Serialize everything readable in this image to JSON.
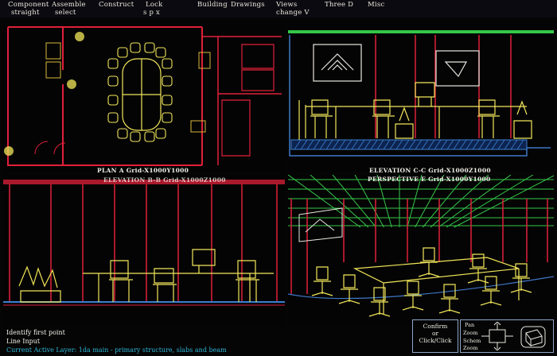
{
  "menu": {
    "row1": [
      "Component",
      "Assemble",
      "Construct",
      "Lock",
      "Building",
      "Drawings",
      "Views",
      "Three D",
      "Misc"
    ],
    "row2": [
      "straight",
      "select",
      "s p x",
      "change V"
    ]
  },
  "viewports": {
    "plan_title": "PLAN A Grid-X1000Y1000",
    "elevation_cc_title": "ELEVATION C-C Grid-X1000Z1000",
    "elevation_bb_title": "ELEVATION B-B Grid-X1000Z1000",
    "perspective_title": "PERSPECTIVE E Grid-X1000Y1000"
  },
  "command": {
    "line1": "Identify first point",
    "line2": "Line Input"
  },
  "status": "Current Active Layer: 1da   main - primary structure, slabs and beam",
  "confirm": {
    "line1": "Confirm",
    "line2": "or",
    "line3": "Click/Click"
  },
  "nav": {
    "pan": "Pan",
    "zoom": "Zoom",
    "scheme": "Schem",
    "zoom2": "Zoom"
  },
  "colors": {
    "wall": "#e0203a",
    "furniture": "#f2e65a",
    "frame": "#3f78c8",
    "grid": "#35c84a",
    "floor": "#3a7fd0",
    "text": "#ece8dd"
  },
  "icons": [
    "compass-icon",
    "layer-cube-icon"
  ]
}
